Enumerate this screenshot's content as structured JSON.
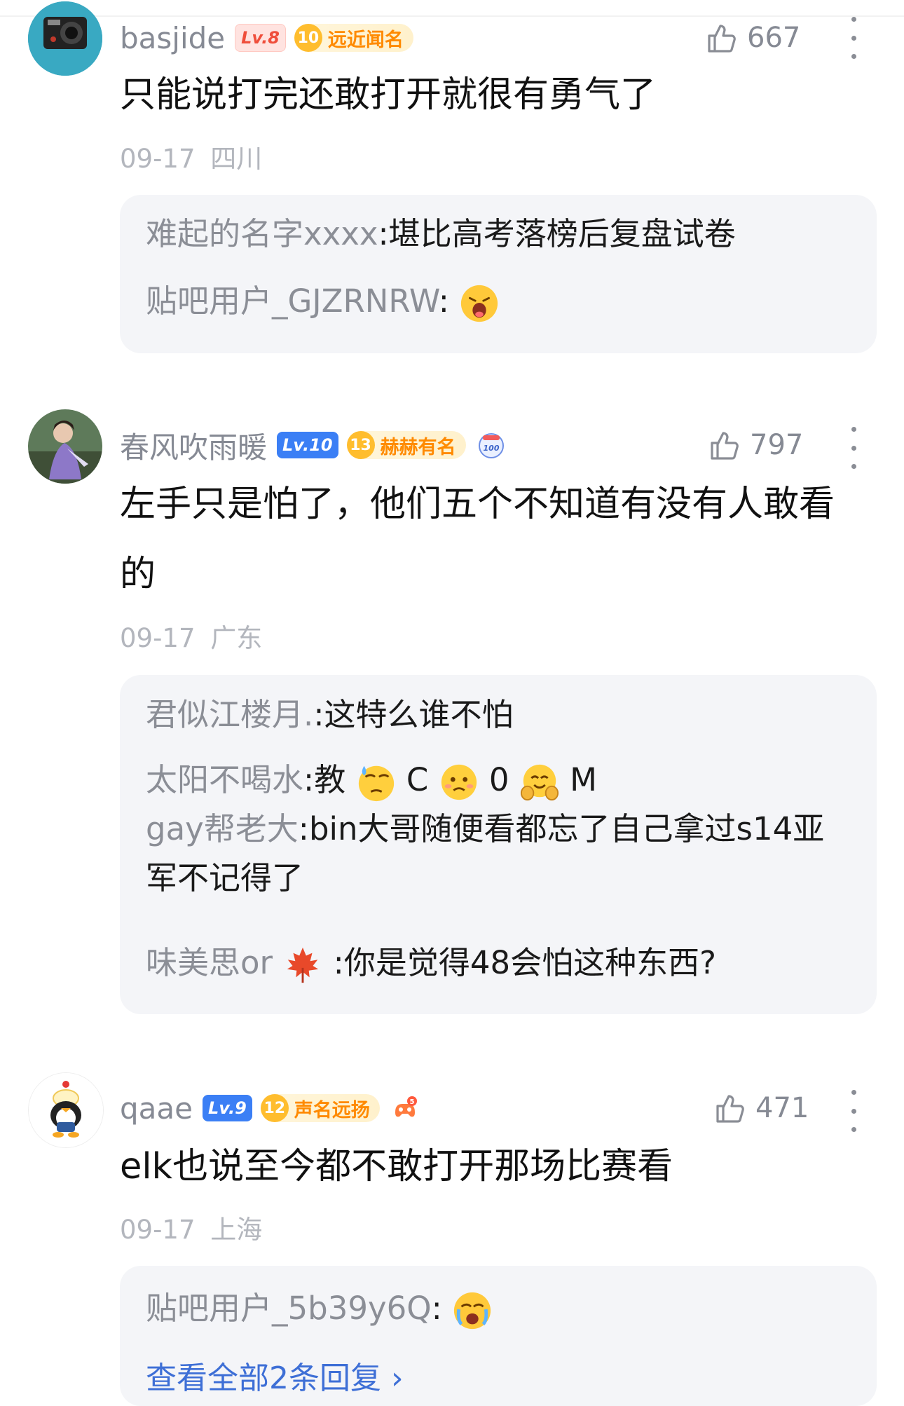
{
  "comments": [
    {
      "username": "basjide",
      "level": "Lv.8",
      "rank_level": "10",
      "rank_title": "远近闻名",
      "likes": "667",
      "text": "只能说打完还敢打开就很有勇气了",
      "date": "09-17",
      "location": "四川",
      "replies": [
        {
          "name": "难起的名字xxxx",
          "sep": ":",
          "text": "堪比高考落榜后复盘试卷"
        },
        {
          "name": "贴吧用户_GJZRNRW",
          "sep": ":",
          "text": ""
        }
      ]
    },
    {
      "username": "春风吹雨暖",
      "level": "Lv.10",
      "rank_level": "13",
      "rank_title": "赫赫有名",
      "likes": "797",
      "text": "左手只是怕了，他们五个不知道有没有人敢看的",
      "date": "09-17",
      "location": "广东",
      "replies": [
        {
          "name": "君似江楼月.",
          "sep": ":",
          "text": "这特么谁不怕"
        },
        {
          "name": "太阳不喝水",
          "sep": ":",
          "text": "教",
          "text2": "C",
          "text3": "0",
          "text4": "M"
        },
        {
          "name": "gay帮老大",
          "sep": ":",
          "text": "bin大哥随便看都忘了自己拿过s14亚军不记得了"
        },
        {
          "name": "味美思or",
          "sep": ":",
          "text": "你是觉得48会怕这种东西?"
        }
      ]
    },
    {
      "username": "qaae",
      "level": "Lv.9",
      "rank_level": "12",
      "rank_title": "声名远扬",
      "likes": "471",
      "text": "elk也说至今都不敢打开那场比赛看",
      "date": "09-17",
      "location": "上海",
      "replies": [
        {
          "name": "贴吧用户_5b39y6Q",
          "sep": ":",
          "text": ""
        }
      ],
      "view_all": "查看全部2条回复 ›"
    }
  ],
  "colors": {
    "username": "#868a94",
    "meta": "#b3b6bd",
    "reply_bg": "#f4f5f8",
    "link": "#3e6fd6",
    "rank_orange": "#ff8a00"
  }
}
